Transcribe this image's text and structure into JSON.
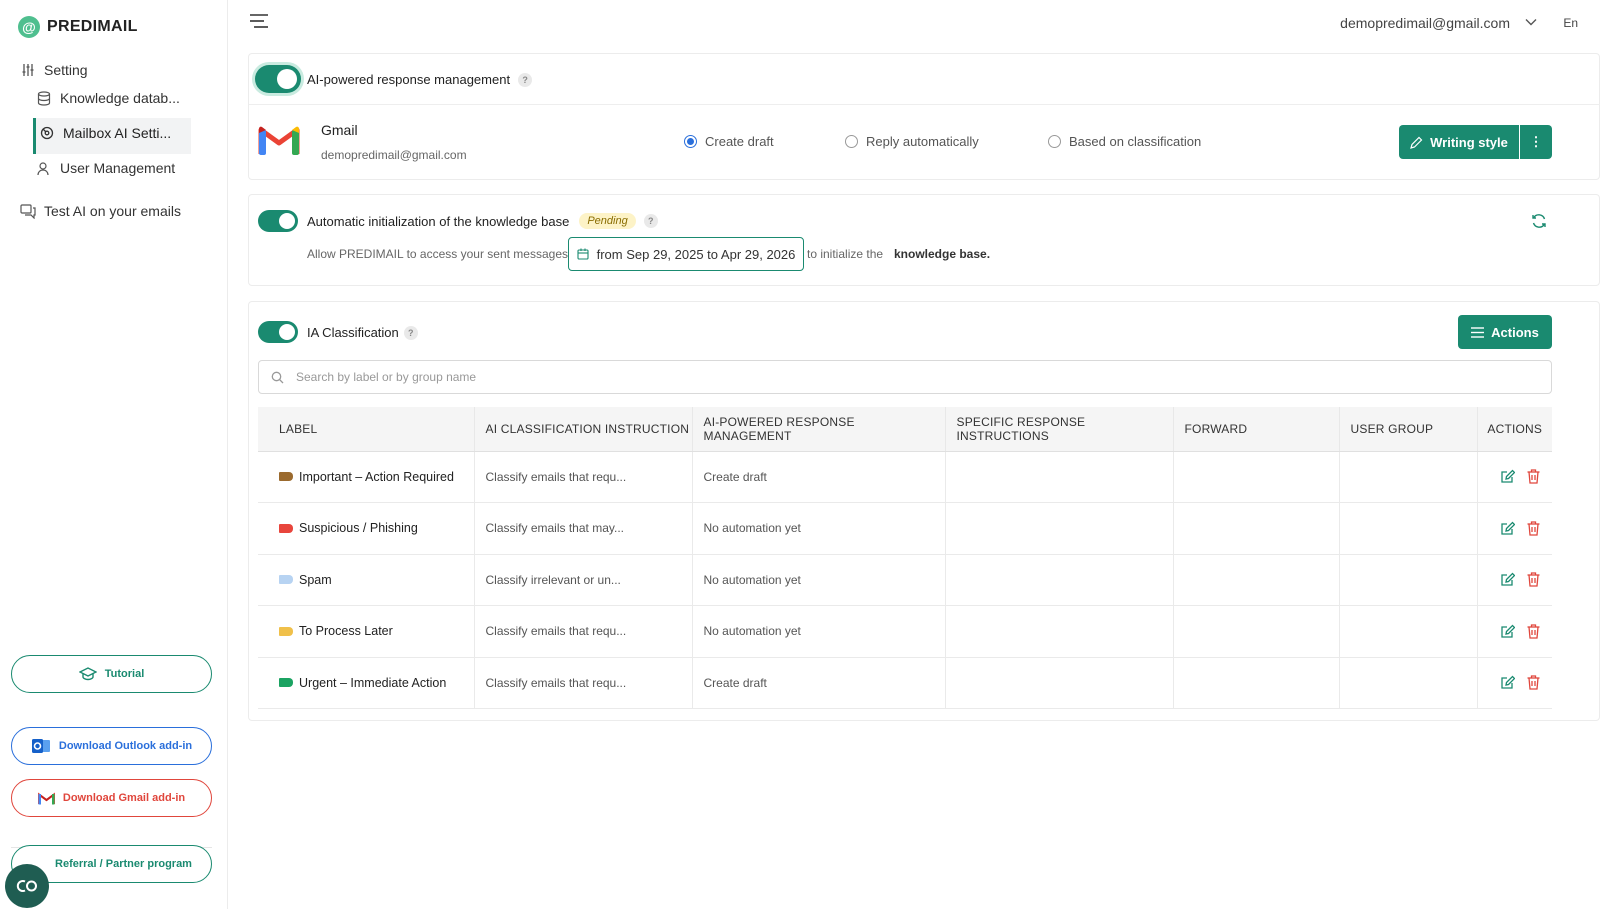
{
  "app": {
    "logo_symbol": "@",
    "name": "PREDIMAIL"
  },
  "sidebar": {
    "items": [
      {
        "label": "Setting",
        "icon": "sliders-icon"
      },
      {
        "label": "Knowledge datab...",
        "icon": "database-icon"
      },
      {
        "label": "Mailbox AI Setti...",
        "icon": "mailbox-settings-icon",
        "active": true
      },
      {
        "label": "User Management",
        "icon": "user-icon"
      },
      {
        "label": "Test AI on your emails",
        "icon": "chat-icon"
      }
    ],
    "buttons": {
      "tutorial": "Tutorial",
      "outlook": "Download Outlook add-in",
      "gmail": "Download Gmail add-in",
      "referral": "Referral / Partner program"
    }
  },
  "header": {
    "email": "demopredimail@gmail.com",
    "language": "En"
  },
  "response_mgmt": {
    "title": "AI-powered response management",
    "help": "?",
    "provider": "Gmail",
    "provider_email": "demopredimail@gmail.com",
    "options": [
      "Create draft",
      "Reply automatically",
      "Based on classification"
    ],
    "selected": "Create draft",
    "writing_style": "Writing style",
    "more": "⋮"
  },
  "knowledge_init": {
    "title": "Automatic initialization of the knowledge base",
    "status": "Pending",
    "help": "?",
    "text_before": "Allow PREDIMAIL to access your sent messages",
    "date_range": "from Sep 29, 2025 to Apr 29, 2026",
    "text_after": "to initialize the",
    "text_bold": "knowledge base."
  },
  "classification": {
    "title": "IA Classification",
    "help": "?",
    "actions_label": "Actions",
    "search_placeholder": "Search by label or by group name",
    "columns": [
      "LABEL",
      "AI CLASSIFICATION INSTRUCTION",
      "AI-POWERED RESPONSE MANAGEMENT",
      "SPECIFIC RESPONSE INSTRUCTIONS",
      "FORWARD",
      "USER GROUP",
      "ACTIONS"
    ],
    "rows": [
      {
        "label": "Important – Action Required",
        "color": "#9b6a2e",
        "instruction": "Classify emails that requ...",
        "response": "Create draft",
        "specific": "",
        "forward": "",
        "group": ""
      },
      {
        "label": "Suspicious / Phishing",
        "color": "#e8453c",
        "instruction": "Classify emails that may...",
        "response": "No automation yet",
        "specific": "",
        "forward": "",
        "group": ""
      },
      {
        "label": "Spam",
        "color": "#b7d3f2",
        "instruction": "Classify irrelevant or un...",
        "response": "No automation yet",
        "specific": "",
        "forward": "",
        "group": ""
      },
      {
        "label": "To Process Later",
        "color": "#f0c04a",
        "instruction": "Classify emails that requ...",
        "response": "No automation yet",
        "specific": "",
        "forward": "",
        "group": ""
      },
      {
        "label": "Urgent – Immediate Action",
        "color": "#1ba362",
        "instruction": "Classify emails that requ...",
        "response": "Create draft",
        "specific": "",
        "forward": "",
        "group": ""
      }
    ]
  },
  "colors": {
    "accent": "#1a8a70",
    "danger": "#e0463c",
    "link": "#2a6fdb"
  }
}
